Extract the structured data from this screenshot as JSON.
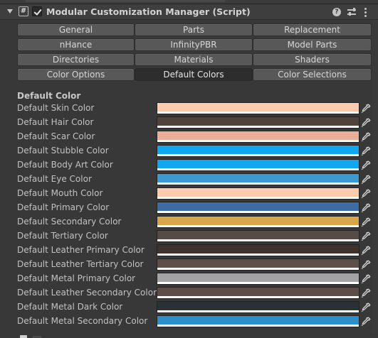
{
  "component": {
    "title": "Modular Customization Manager (Script)",
    "script_icon": "#",
    "enabled": true,
    "icons": {
      "help": "help-icon",
      "presets": "presets-icon",
      "menu": "kebab-menu-icon"
    },
    "help_glyph": "?"
  },
  "tabs": [
    {
      "label": "General",
      "selected": false
    },
    {
      "label": "Parts",
      "selected": false
    },
    {
      "label": "Replacement",
      "selected": false
    },
    {
      "label": "nHance",
      "selected": false
    },
    {
      "label": "InfinityPBR",
      "selected": false
    },
    {
      "label": "Model Parts",
      "selected": false
    },
    {
      "label": "Directories",
      "selected": false
    },
    {
      "label": "Materials",
      "selected": false
    },
    {
      "label": "Shaders",
      "selected": false
    },
    {
      "label": "Color Options",
      "selected": false
    },
    {
      "label": "Default Colors",
      "selected": true
    },
    {
      "label": "Color Selections",
      "selected": false
    }
  ],
  "section": {
    "label": "Default Color"
  },
  "colors": [
    {
      "label": "Default Skin Color",
      "color": "#fdccae"
    },
    {
      "label": "Default Hair Color",
      "color": "#4f433c"
    },
    {
      "label": "Default Scar Color",
      "color": "#e8ae9a"
    },
    {
      "label": "Default Stubble Color",
      "color": "#0ea7f0"
    },
    {
      "label": "Default Body Art Color",
      "color": "#0ea7f0"
    },
    {
      "label": "Default Eye Color",
      "color": "#3a9ad1"
    },
    {
      "label": "Default Mouth Color",
      "color": "#fdccae"
    },
    {
      "label": "Default Primary Color",
      "color": "#3d6ca4"
    },
    {
      "label": "Default Secondary Color",
      "color": "#d7a54a"
    },
    {
      "label": "Default Tertiary Color",
      "color": "#574c45"
    },
    {
      "label": "Default Leather Primary Color",
      "color": "#3f332d"
    },
    {
      "label": "Default Leather Tertiary Color",
      "color": "#5e5049"
    },
    {
      "label": "Default Metal Primary Color",
      "color": "#a3a3a5"
    },
    {
      "label": "Default Leather Secondary Color",
      "color": "#5c4e47"
    },
    {
      "label": "Default Metal Dark Color",
      "color": "#2b3236"
    },
    {
      "label": "Default Metal Secondary Color",
      "color": "#2c8fcc"
    }
  ],
  "picker_icon": "eyedropper-icon"
}
